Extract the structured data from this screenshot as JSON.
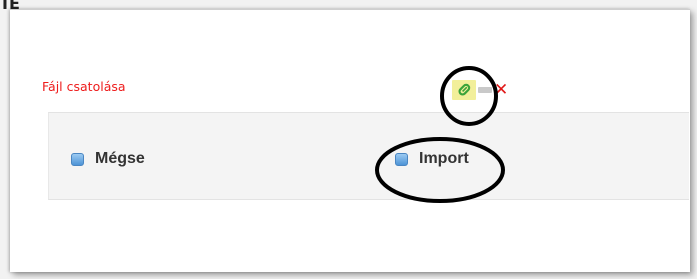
{
  "window": {
    "top_label": "IE"
  },
  "attachment": {
    "label": "Fájl csatolása",
    "icons": [
      "paperclip-icon",
      "bar-icon",
      "delete-icon"
    ],
    "delete_glyph": "✕"
  },
  "buttons": {
    "cancel_label": "Mégse",
    "import_label": "Import"
  },
  "colors": {
    "attach_label": "#ee1c1c",
    "delete_icon": "#e01818",
    "paperclip_highlight": "#f2ef9a",
    "paperclip_green": "#3aa33a",
    "button_square": "#5aa0e0",
    "annotation": "#000000"
  }
}
